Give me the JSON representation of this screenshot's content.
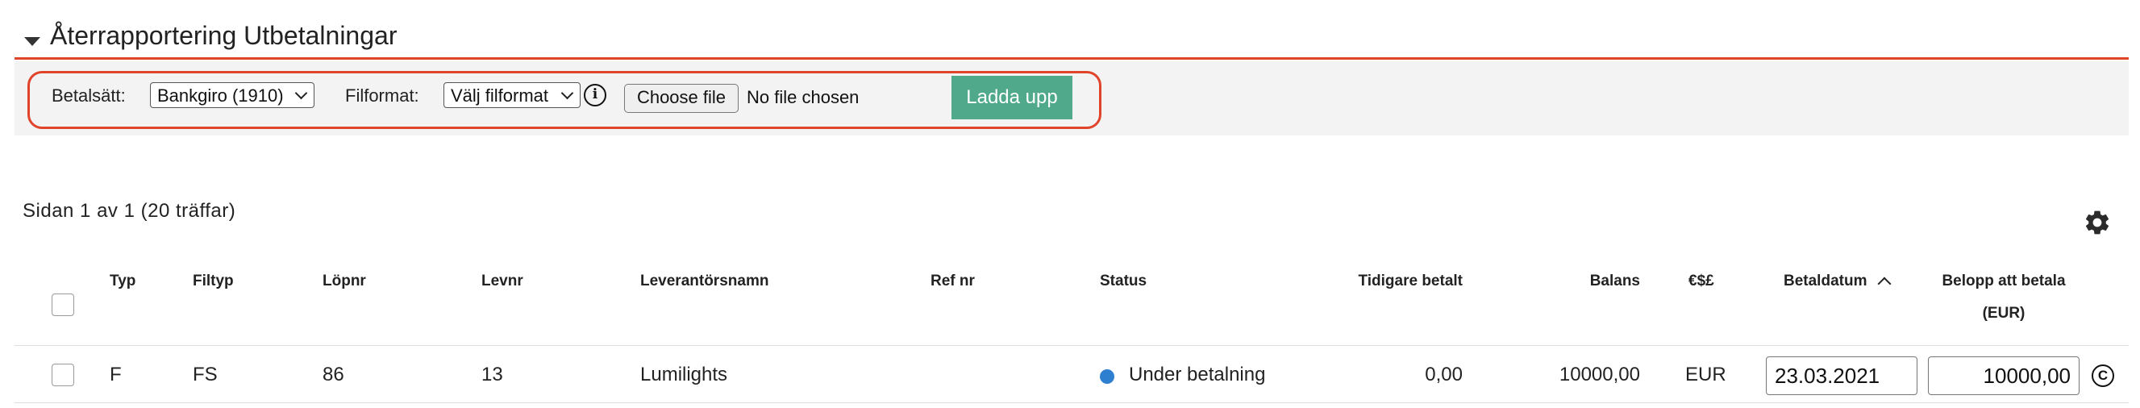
{
  "section": {
    "title": "Återrapportering Utbetalningar"
  },
  "upload": {
    "payment_method_label": "Betalsätt:",
    "payment_method_value": "Bankgiro (1910)",
    "file_format_label": "Filformat:",
    "file_format_value": "Välj filformat",
    "choose_file_label": "Choose file",
    "no_file_text": "No file chosen",
    "upload_button": "Ladda upp"
  },
  "pagination": {
    "text": "Sidan 1 av 1  (20 träffar)"
  },
  "table": {
    "columns": {
      "typ": "Typ",
      "filtyp": "Filtyp",
      "lopnr": "Löpnr",
      "levnr": "Levnr",
      "leverantorsnamn": "Leverantörsnamn",
      "refnr": "Ref nr",
      "status": "Status",
      "tidigare_betalt": "Tidigare betalt",
      "balans": "Balans",
      "currency": "€$£",
      "betaldatum": "Betaldatum",
      "belopp_line1": "Belopp att betala",
      "belopp_line2": "(EUR)"
    },
    "rows": [
      {
        "typ": "F",
        "filtyp": "FS",
        "lopnr": "86",
        "levnr": "13",
        "leverantorsnamn": "Lumilights",
        "refnr": "",
        "status": "Under betalning",
        "tidigare_betalt": "0,00",
        "balans": "10000,00",
        "currency": "EUR",
        "betaldatum": "23.03.2021",
        "belopp": "10000,00"
      }
    ]
  },
  "colors": {
    "accent": "#e0452b",
    "upload_button": "#4fa98a",
    "status_dot": "#2f7fd1"
  },
  "icons": [
    "caret-down-icon",
    "info-icon",
    "gear-icon",
    "sort-ascending-icon",
    "copy-icon"
  ]
}
